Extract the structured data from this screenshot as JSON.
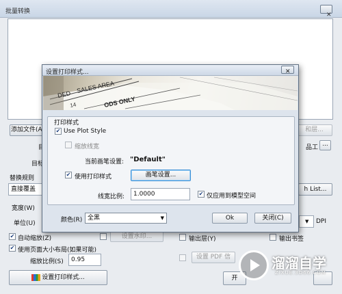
{
  "main": {
    "title": "批量转换",
    "close_symbol": "✕",
    "add_file_label": "添加文件(A...",
    "merge_layer_label": "和层...",
    "fragment_mu": "目",
    "fragment_mubiao": "目标",
    "fragment_tool": "品工",
    "ellipsis_label": "...",
    "replace_rule_label": "替换规则",
    "replace_select_value": "直接覆盖",
    "path_list_label": "h List...",
    "width_label": "宽度(W)",
    "unit_label": "单位(U)",
    "dpi_label": "DPI",
    "auto_zoom_label": "自动缩放(Z)",
    "watermark_button_label": "设置水印...",
    "output_layer_label": "输出层(Y)",
    "output_bookmark_label": "输出书签",
    "use_page_size_label": "使用页面大小布局(如果可能)",
    "set_pdf_button_label": "设置 PDF 信",
    "zoom_ratio_label": "缩放比例(S)",
    "zoom_ratio_value": "0.95",
    "plot_style_button_label": "设置打印样式...",
    "start_fragment": "开"
  },
  "dialog": {
    "title": "设置打印样式...",
    "close_symbol": "✕",
    "banner_texts": [
      "DED",
      "SALES AREA",
      "ODS ONLY",
      "14"
    ],
    "group_title": "打印样式",
    "use_plot_style_label": "Use Plot Style",
    "scale_lineweight_label": "缩放线宽",
    "current_pen_label": "当前画笔设置:",
    "current_pen_value": "\"Default\"",
    "use_print_style_label": "使用打印样式",
    "pen_settings_button_label": "画笔设置...",
    "line_ratio_label": "线宽比例:",
    "line_ratio_value": "1.0000",
    "model_space_only_label": "仅应用到模型空间",
    "color_label": "颜色(R)",
    "color_value": "全黑",
    "ok_label": "Ok",
    "close_label": "关闭(C)"
  },
  "checkboxes": {
    "use_plot_style": true,
    "scale_lineweight": false,
    "use_print_style": true,
    "model_space_only": true,
    "auto_zoom": true,
    "watermark": false,
    "output_layer": false,
    "output_bookmark": false,
    "use_page_size": true,
    "set_pdf": false
  },
  "watermark": {
    "brand_cn": "溜溜自学",
    "brand_url": "ZIXUE.3D66.COM"
  },
  "colors": {
    "title_bar": "#c9d6e6",
    "dialog_bg": "#dde4ed",
    "group_bg": "#f3f5f8",
    "primary_button_border": "#3a8fd6"
  }
}
